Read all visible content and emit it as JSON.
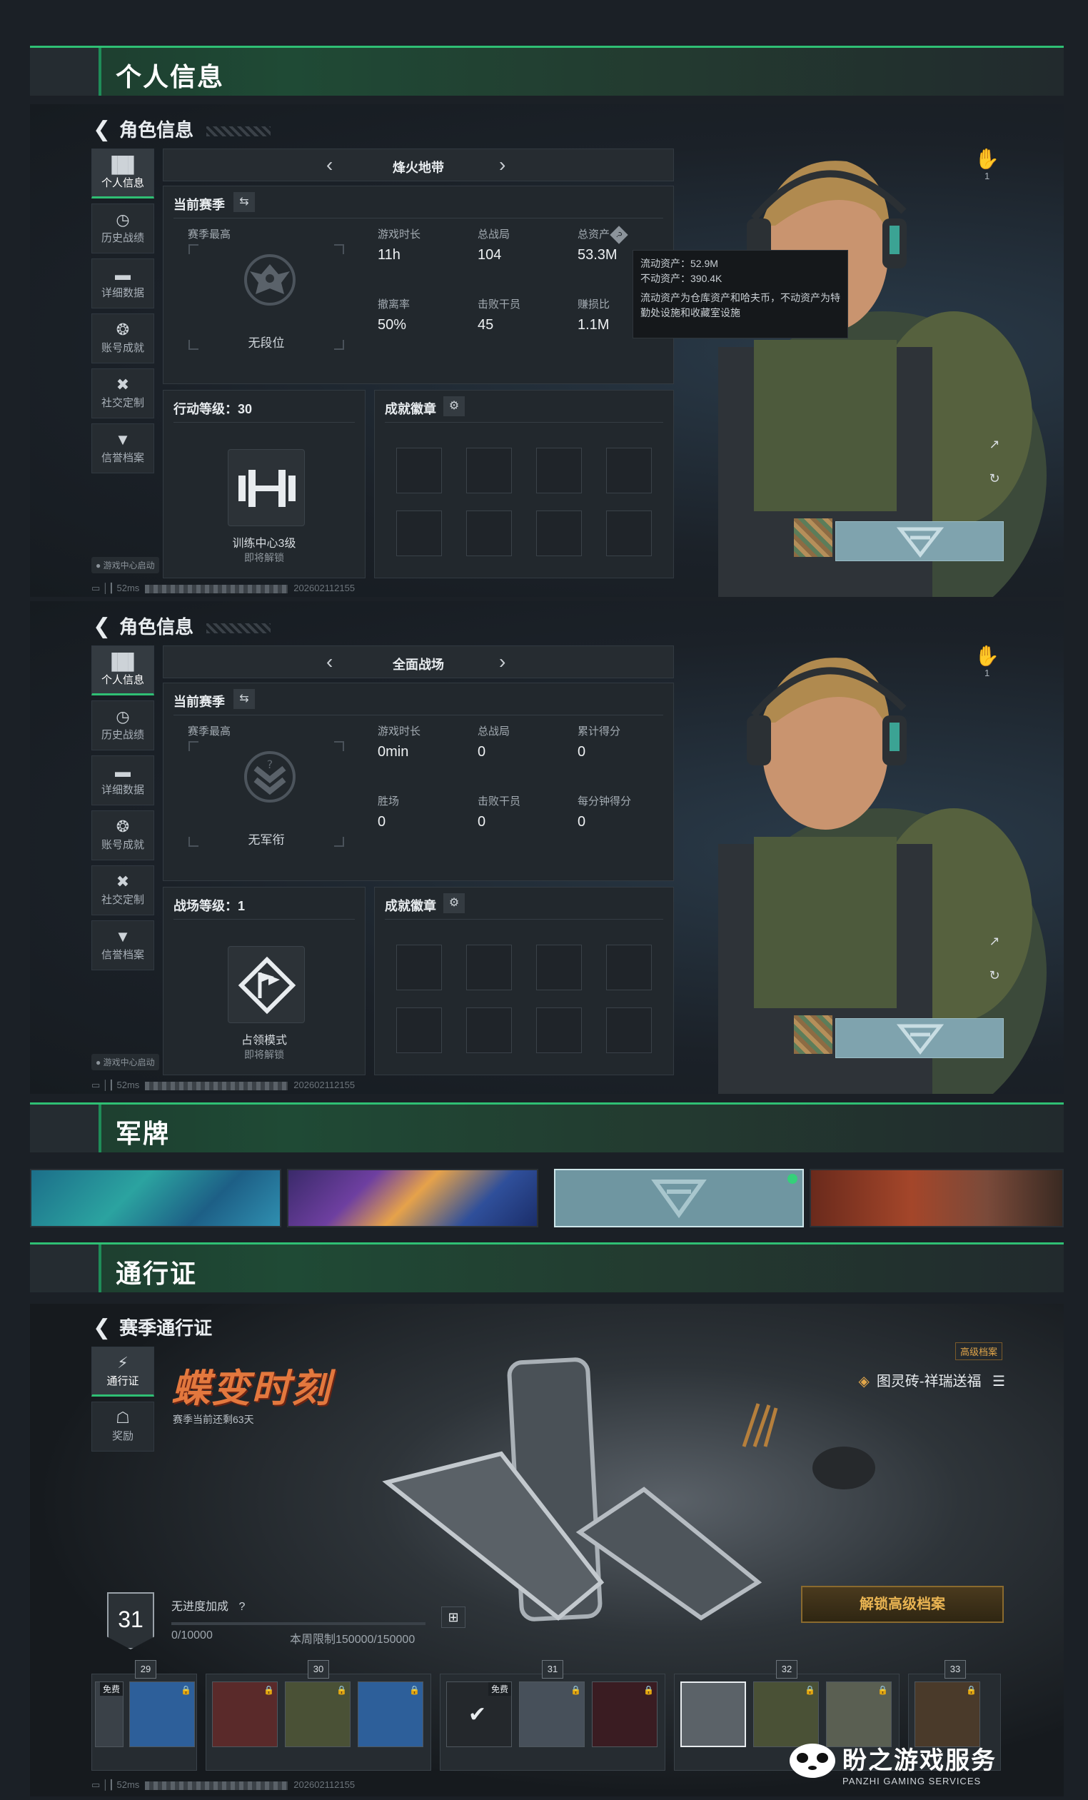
{
  "sections": {
    "profile": "个人信息",
    "dogtags": "军牌",
    "pass": "通行证"
  },
  "panel1": {
    "back_title": "角色信息",
    "sidebar": [
      "个人信息",
      "历史战绩",
      "详细数据",
      "账号成就",
      "社交定制",
      "信誉档案"
    ],
    "mode": "烽火地带",
    "season_label": "当前赛季",
    "season_best": "赛季最高",
    "rank_name": "无段位",
    "stats": [
      {
        "k": "游戏时长",
        "v": "11h"
      },
      {
        "k": "总战局",
        "v": "104"
      },
      {
        "k": "总资产",
        "v": "53.3M"
      },
      {
        "k": "撤离率",
        "v": "50%"
      },
      {
        "k": "击败干员",
        "v": "45"
      },
      {
        "k": "赚损比",
        "v": "1.1M"
      }
    ],
    "level_label": "行动等级：30",
    "level_item": "训练中心3级",
    "level_lock": "即将解锁",
    "badges_label": "成就徽章",
    "likes": "1",
    "tooltip": {
      "liquid": "流动资产：52.9M",
      "fixed": "不动资产：390.4K",
      "desc": "流动资产为仓库资产和哈夫币，不动资产为特勤处设施和收藏室设施"
    },
    "footnote": "游戏中心启动",
    "latency": "52ms",
    "id": "202602112155"
  },
  "panel2": {
    "back_title": "角色信息",
    "sidebar": [
      "个人信息",
      "历史战绩",
      "详细数据",
      "账号成就",
      "社交定制",
      "信誉档案"
    ],
    "mode": "全面战场",
    "season_label": "当前赛季",
    "season_best": "赛季最高",
    "rank_name": "无军衔",
    "stats": [
      {
        "k": "游戏时长",
        "v": "0min"
      },
      {
        "k": "总战局",
        "v": "0"
      },
      {
        "k": "累计得分",
        "v": "0"
      },
      {
        "k": "胜场",
        "v": "0"
      },
      {
        "k": "击败干员",
        "v": "0"
      },
      {
        "k": "每分钟得分",
        "v": "0"
      }
    ],
    "level_label": "战场等级：1",
    "level_item": "占领模式",
    "level_lock": "即将解锁",
    "badges_label": "成就徽章",
    "likes": "1",
    "footnote": "游戏中心启动",
    "latency": "52ms",
    "id": "202602112155"
  },
  "pass": {
    "back_title": "赛季通行证",
    "sidebar": [
      "通行证",
      "奖励"
    ],
    "event_title": "蝶变时刻",
    "remaining": "赛季当前还剩63天",
    "adv_tag": "高级档案",
    "reward_name": "图灵砖-祥瑞送福",
    "level": "31",
    "progress_label": "无进度加成",
    "progress": "0/10000",
    "progress_fraction": 0.0,
    "weekly": "本周限制150000/150000",
    "unlock": "解锁高级档案",
    "tiers": [
      "29",
      "30",
      "31",
      "32",
      "33"
    ],
    "free_label": "免费",
    "latency": "52ms",
    "id": "202602112155"
  },
  "watermark": {
    "title": "盼之游戏服务",
    "subtitle": "PANZHI GAMING SERVICES"
  },
  "colors": {
    "accent": "#2fbf74",
    "gold": "#e2a64a",
    "orange_title": "#e3783e"
  }
}
